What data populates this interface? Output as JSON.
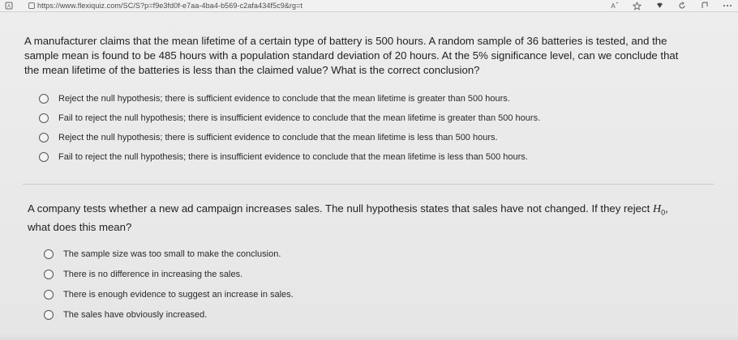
{
  "browser": {
    "url": "https://www.flexiquiz.com/SC/S?p=f9e3fd0f-e7aa-4ba4-b569-c2afa434f5c9&rg=t",
    "left_icons": [
      "reader-icon",
      "lock-icon"
    ],
    "right_icons": [
      "read-aloud-icon",
      "favorite-star-icon",
      "extension-icon",
      "refresh-icon",
      "collections-icon",
      "more-icon"
    ]
  },
  "question1": {
    "text": "A manufacturer claims that the mean lifetime of a certain type of battery is 500 hours. A random sample of 36 batteries is tested, and the sample mean is found to be 485 hours with a population standard deviation of 20 hours. At the 5% significance level, can we conclude that the mean lifetime of the batteries is less than the claimed value? What is the correct conclusion?",
    "options": [
      "Reject the null hypothesis; there is sufficient evidence to conclude that the mean lifetime is greater than 500 hours.",
      "Fail to reject the null hypothesis; there is insufficient evidence to conclude that the mean lifetime is greater than 500 hours.",
      "Reject the null hypothesis; there is sufficient evidence to conclude that the mean lifetime is less than 500 hours.",
      "Fail to reject the null hypothesis; there is insufficient evidence to conclude that the mean lifetime is less than 500 hours."
    ]
  },
  "question2": {
    "text_before": "A company tests whether a new ad campaign increases sales. The null hypothesis states that sales have not changed. If they reject ",
    "symbol": "H",
    "subscript": "0",
    "text_after": ", what does this mean?",
    "options": [
      "The sample size was too small to make the conclusion.",
      "There is no difference in increasing the sales.",
      "There is enough evidence to suggest an increase in sales.",
      "The sales have obviously increased."
    ]
  }
}
